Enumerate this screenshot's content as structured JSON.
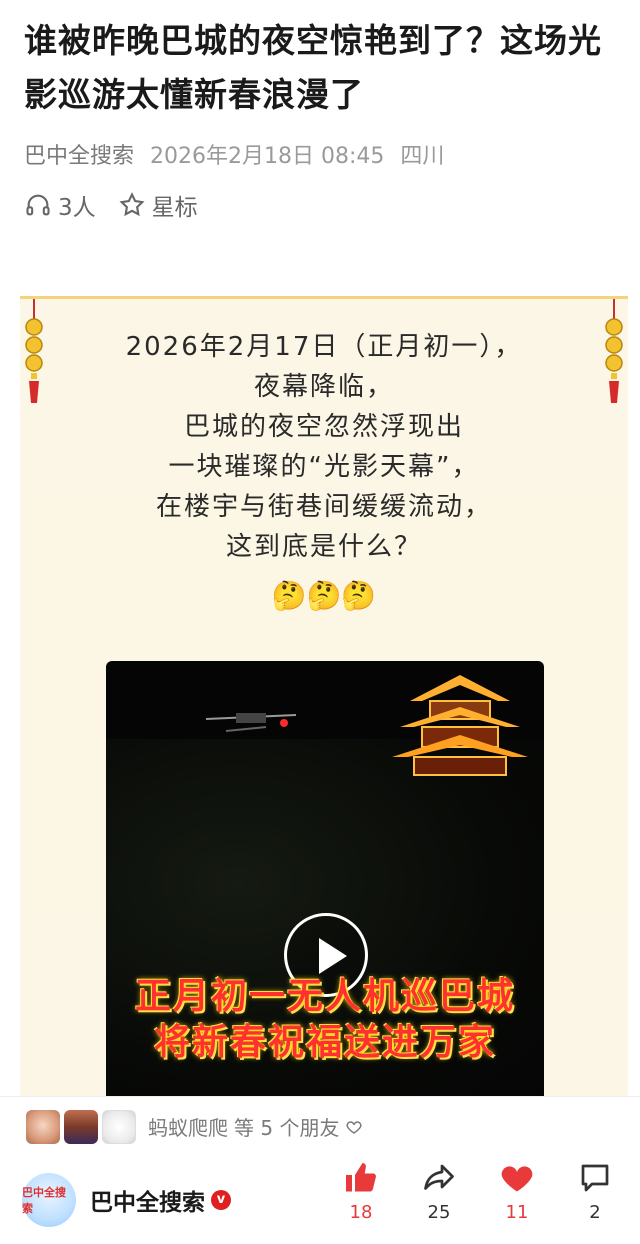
{
  "article": {
    "title": "谁被昨晚巴城的夜空惊艳到了？这场光影巡游太懂新春浪漫了",
    "source": "巴中全搜索",
    "datetime": "2026年2月18日 08:45",
    "location": "四川",
    "listeners": "3人",
    "star_label": "星标"
  },
  "poster": {
    "lines": [
      "2026年2月17日（正月初一），",
      "夜幕降临，",
      "巴城的夜空忽然浮现出",
      "一块璀璨的“光影天幕”，",
      "在楼宇与街巷间缓缓流动，",
      "这到底是什么？"
    ],
    "emojis": "🤔🤔🤔"
  },
  "video": {
    "caption_line1": "正月初一无人机巡巴城",
    "caption_line2": "将新春祝福送进万家"
  },
  "friends": {
    "name": "蚂蚁爬爬",
    "suffix": "等 5 个朋友"
  },
  "footer": {
    "account_name": "巴中全搜索",
    "logo_text": "巴中全搜索",
    "verified_mark": "v",
    "likes": "18",
    "shares": "25",
    "favorites": "11",
    "comments": "2"
  },
  "colors": {
    "accent_red": "#e83a3a",
    "poster_bg": "#fbf6e6",
    "caption_red": "#ff3030"
  }
}
